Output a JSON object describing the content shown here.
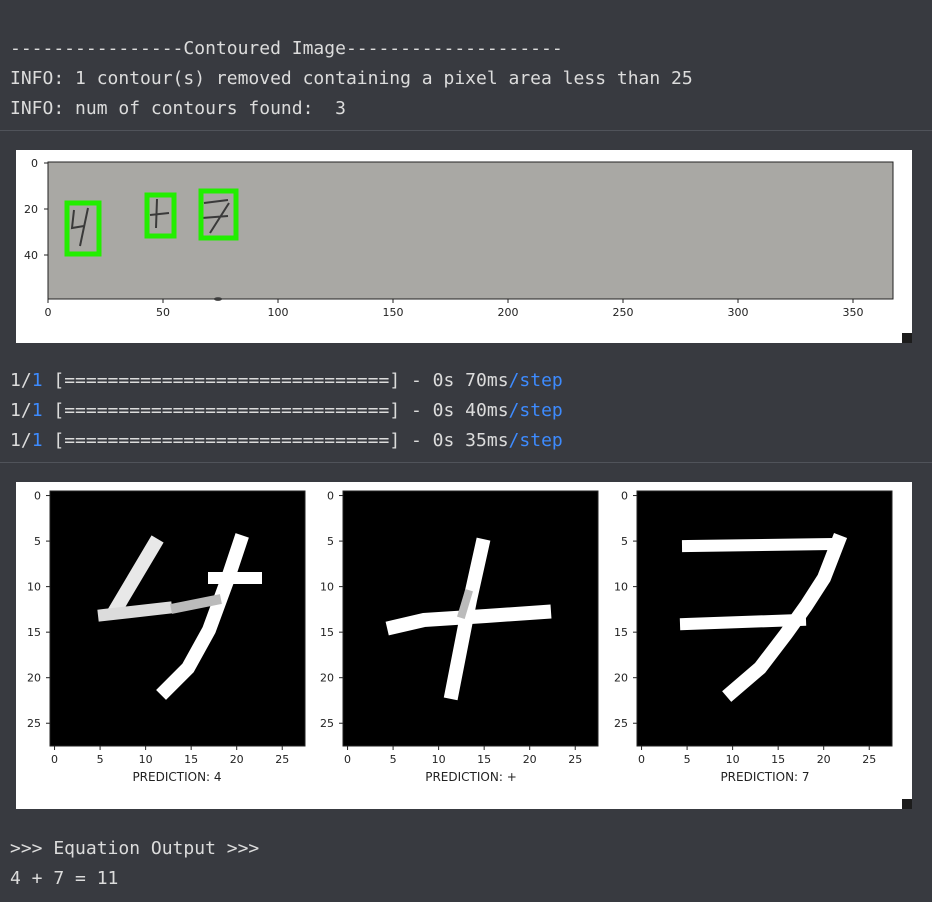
{
  "output1": {
    "lines": [
      "----------------Contoured Image--------------------",
      "INFO: 1 contour(s) removed containing a pixel area less than 25",
      "INFO: num of contours found:  3"
    ]
  },
  "figure1": {
    "xticks": [
      "0",
      "50",
      "100",
      "150",
      "200",
      "250",
      "300",
      "350"
    ],
    "yticks": [
      "0",
      "20",
      "40"
    ],
    "bg_color": "#a9a8a4",
    "box_color": "#22ee00"
  },
  "progress": [
    {
      "count_num": "1",
      "count_den": "1",
      "bar": "[==============================]",
      "time": "- 0s 70ms",
      "unit": "step"
    },
    {
      "count_num": "1",
      "count_den": "1",
      "bar": "[==============================]",
      "time": "- 0s 40ms",
      "unit": "step"
    },
    {
      "count_num": "1",
      "count_den": "1",
      "bar": "[==============================]",
      "time": "- 0s 35ms",
      "unit": "step"
    }
  ],
  "figure2": {
    "xticks": [
      "0",
      "5",
      "10",
      "15",
      "20",
      "25"
    ],
    "yticks": [
      "0",
      "5",
      "10",
      "15",
      "20",
      "25"
    ],
    "panels": [
      {
        "xlabel": "PREDICTION: 4"
      },
      {
        "xlabel": "PREDICTION: +"
      },
      {
        "xlabel": "PREDICTION: 7"
      }
    ]
  },
  "output3": {
    "header": ">>> Equation Output >>>",
    "result": "4 + 7 = 11"
  }
}
